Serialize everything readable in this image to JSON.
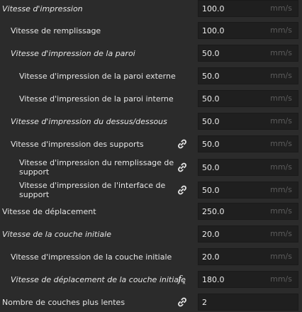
{
  "settings": [
    {
      "label": "Vitesse d'impression",
      "italic": true,
      "value": "100.0",
      "unit": "mm/s",
      "icon": ""
    },
    {
      "label": "Vitesse de remplissage",
      "italic": false,
      "value": "100.0",
      "unit": "mm/s",
      "icon": ""
    },
    {
      "label": "Vitesse d'impression de la paroi",
      "italic": true,
      "value": "50.0",
      "unit": "mm/s",
      "icon": ""
    },
    {
      "label": "Vitesse d'impression de la paroi externe",
      "italic": false,
      "value": "50.0",
      "unit": "mm/s",
      "icon": ""
    },
    {
      "label": "Vitesse d'impression de la paroi interne",
      "italic": false,
      "value": "50.0",
      "unit": "mm/s",
      "icon": ""
    },
    {
      "label": "Vitesse d'impression du dessus/dessous",
      "italic": true,
      "value": "50.0",
      "unit": "mm/s",
      "icon": ""
    },
    {
      "label": "Vitesse d'impression des supports",
      "italic": false,
      "value": "50.0",
      "unit": "mm/s",
      "icon": "link-icon"
    },
    {
      "label": "Vitesse d'impression du remplissage de support",
      "italic": false,
      "value": "50.0",
      "unit": "mm/s",
      "icon": "link-icon"
    },
    {
      "label": "Vitesse d'impression de l'interface de support",
      "italic": false,
      "value": "50.0",
      "unit": "mm/s",
      "icon": "link-icon"
    },
    {
      "label": "Vitesse de déplacement",
      "italic": false,
      "value": "250.0",
      "unit": "mm/s",
      "icon": ""
    },
    {
      "label": "Vitesse de la couche initiale",
      "italic": true,
      "value": "20.0",
      "unit": "mm/s",
      "icon": ""
    },
    {
      "label": "Vitesse d'impression de la couche initiale",
      "italic": false,
      "value": "20.0",
      "unit": "mm/s",
      "icon": ""
    },
    {
      "label": "Vitesse de déplacement de la couche initiale",
      "italic": true,
      "value": "180.0",
      "unit": "mm/s",
      "icon": "function-icon"
    },
    {
      "label": "Nombre de couches plus lentes",
      "italic": false,
      "value": "2",
      "unit": "",
      "icon": "link-icon"
    }
  ],
  "icons": {
    "link-icon": "chain link",
    "function-icon": "fx"
  }
}
